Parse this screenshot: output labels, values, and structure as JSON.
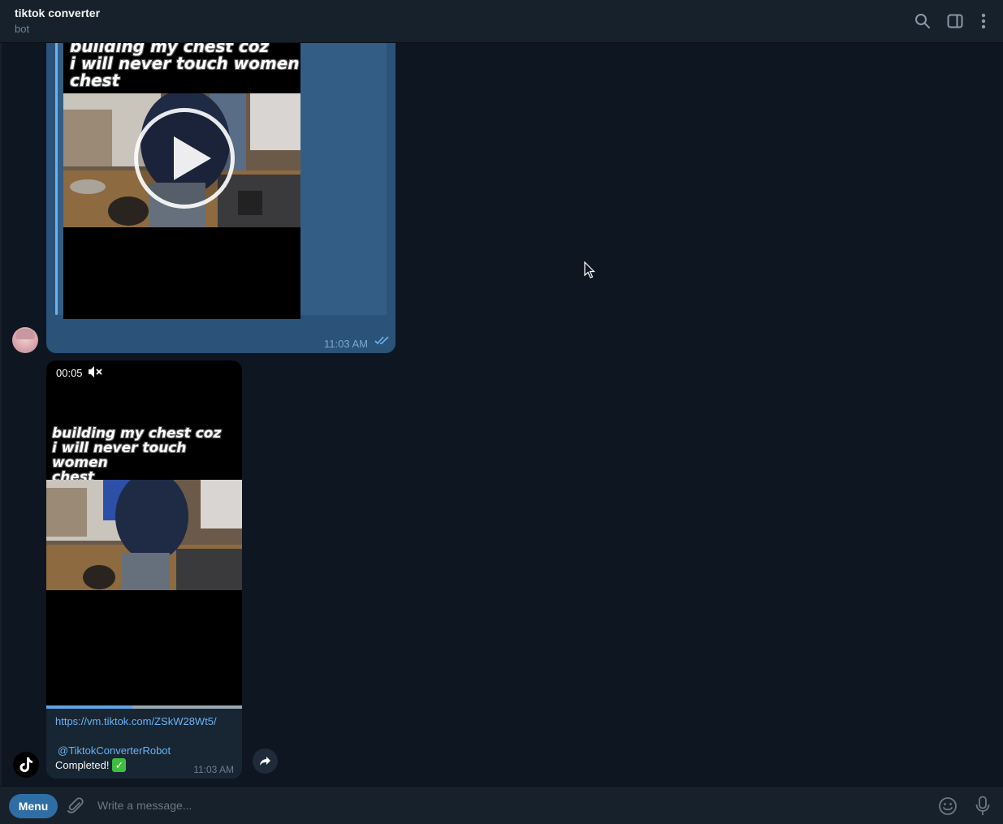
{
  "header": {
    "title": "tiktok converter",
    "subtitle": "bot",
    "icons": [
      "search-icon",
      "sidebar-toggle-icon",
      "more-vertical-icon"
    ]
  },
  "forwarded_message": {
    "video_caption_lines": [
      "building my chest coz",
      "i will never touch women",
      "chest"
    ],
    "time": "11:03 AM",
    "status": "read",
    "sender_avatar": "user-avatar"
  },
  "bot_message": {
    "video_duration": "00:05",
    "video_muted": true,
    "video_caption_lines": [
      "building my chest coz",
      "i will never touch women",
      "chest"
    ],
    "video_progress": 0.44,
    "link": "https://vm.tiktok.com/ZSkW28Wt5/",
    "mention": "@TiktokConverterRobot",
    "text": "Completed!",
    "emoji": "✓",
    "time": "11:03 AM",
    "sender_avatar": "tiktok-logo"
  },
  "composer": {
    "menu_label": "Menu",
    "placeholder": "Write a message..."
  },
  "colors": {
    "background": "#0e1621",
    "header": "#17212b",
    "outgoing_bubble": "#2b5278",
    "incoming_bubble": "#182533",
    "accent": "#6ab3f3",
    "menu_button": "#2f6ea5"
  }
}
